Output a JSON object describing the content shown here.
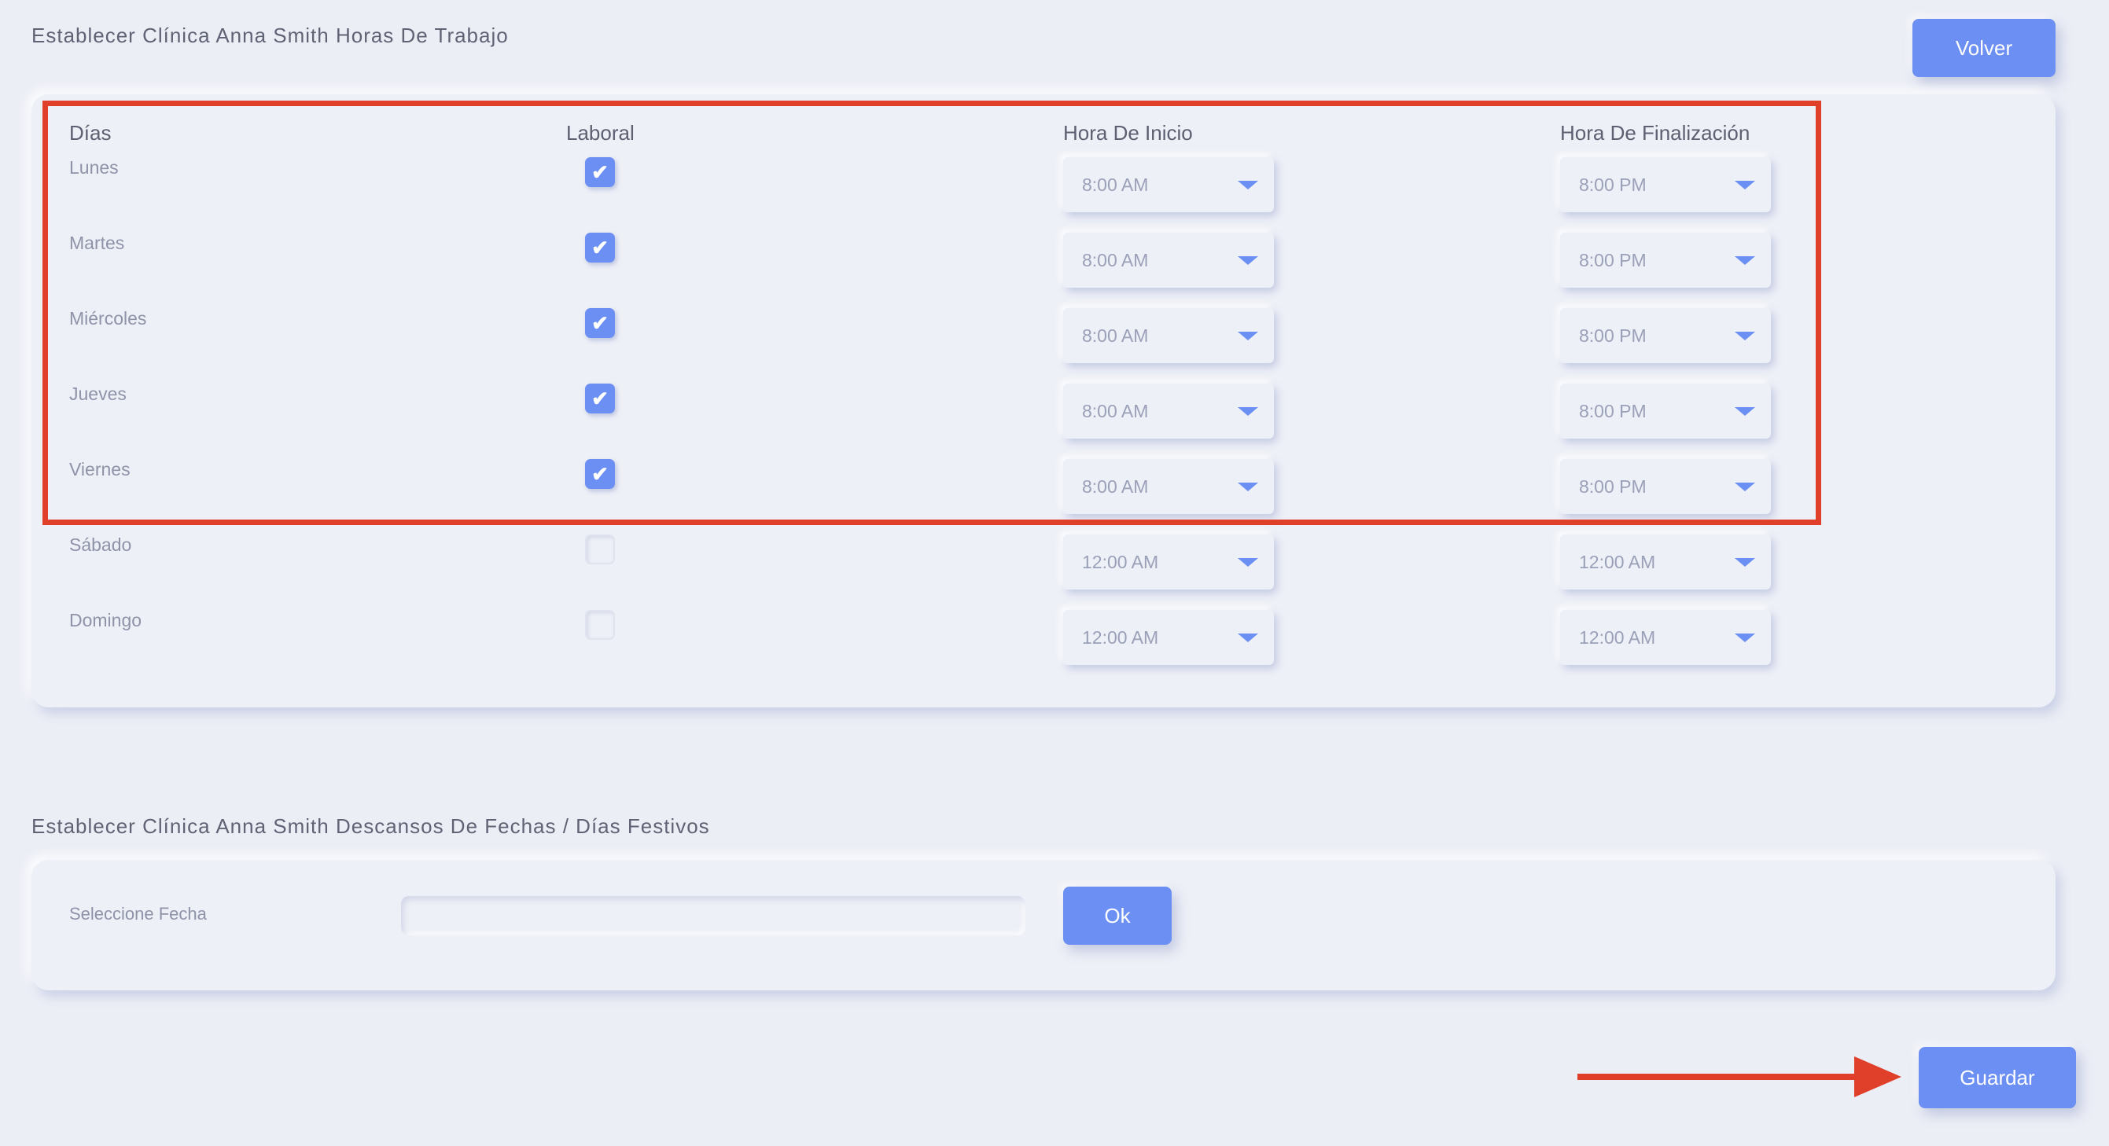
{
  "hours_section": {
    "title": "Establecer Clínica Anna Smith Horas De Trabajo",
    "back_label": "Volver",
    "headers": {
      "days": "Días",
      "working": "Laboral",
      "start": "Hora De Inicio",
      "end": "Hora De Finalización"
    },
    "rows": [
      {
        "day": "Lunes",
        "working": true,
        "start": "8:00 AM",
        "end": "8:00 PM"
      },
      {
        "day": "Martes",
        "working": true,
        "start": "8:00 AM",
        "end": "8:00 PM"
      },
      {
        "day": "Miércoles",
        "working": true,
        "start": "8:00 AM",
        "end": "8:00 PM"
      },
      {
        "day": "Jueves",
        "working": true,
        "start": "8:00 AM",
        "end": "8:00 PM"
      },
      {
        "day": "Viernes",
        "working": true,
        "start": "8:00 AM",
        "end": "8:00 PM"
      },
      {
        "day": "Sábado",
        "working": false,
        "start": "12:00 AM",
        "end": "12:00 AM"
      },
      {
        "day": "Domingo",
        "working": false,
        "start": "12:00 AM",
        "end": "12:00 AM"
      }
    ],
    "checkmark_glyph": "✔"
  },
  "breaks_section": {
    "title": "Establecer Clínica Anna Smith Descansos De Fechas / Días Festivos",
    "date_label": "Seleccione Fecha",
    "date_value": "",
    "ok_label": "Ok"
  },
  "save_label": "Guardar",
  "colors": {
    "accent": "#6b8ff2",
    "annotation": "#e0402a",
    "background": "#eceef6"
  },
  "icons": {
    "dropdown": "caret-down-icon",
    "check": "check-icon",
    "annotation_arrow": "arrow-right-icon"
  }
}
